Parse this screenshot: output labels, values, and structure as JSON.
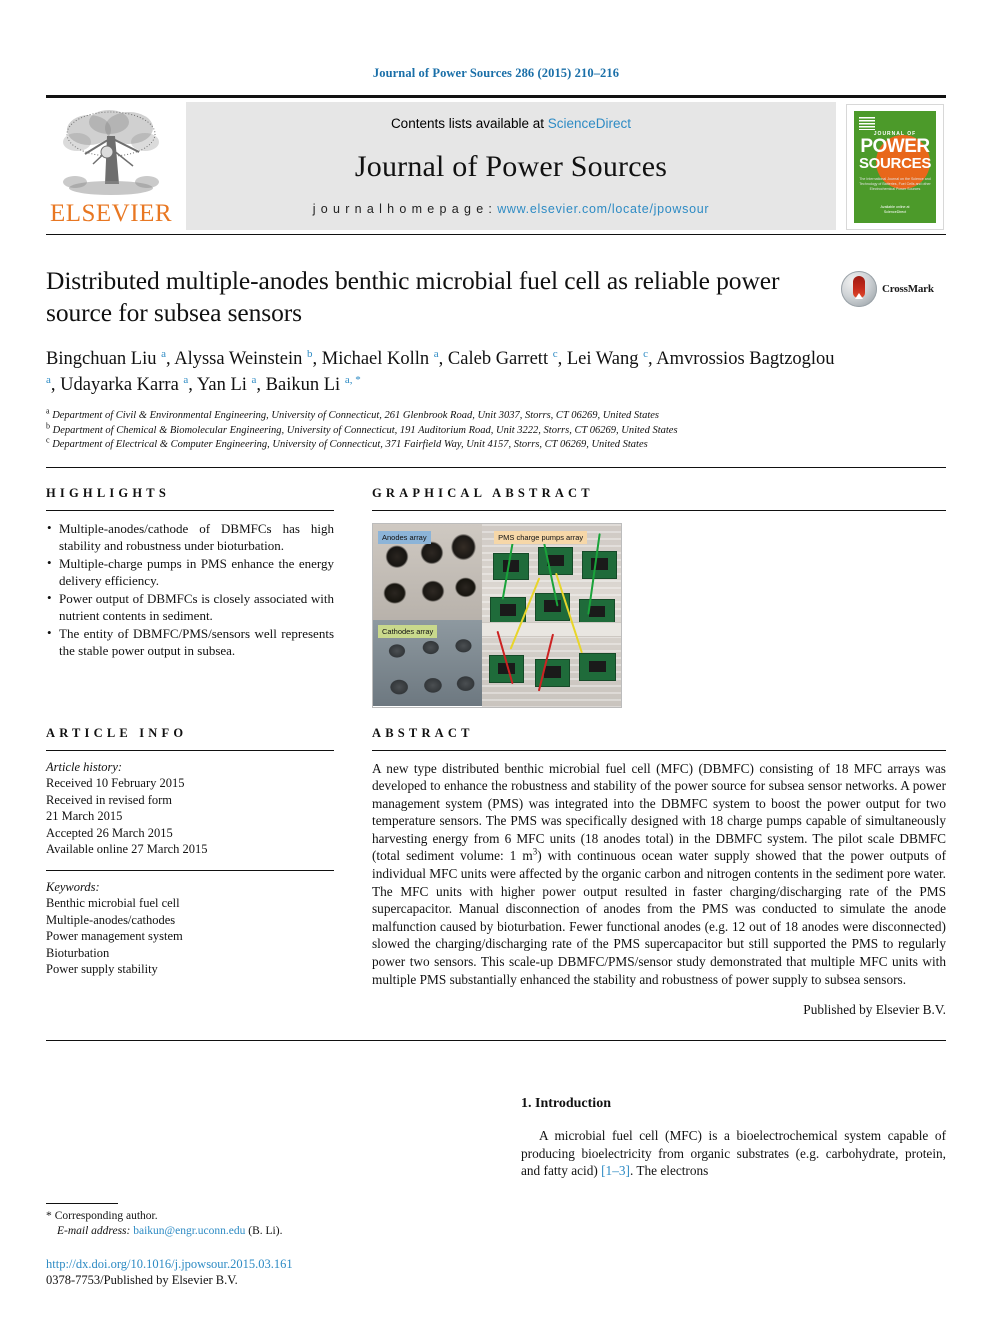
{
  "running_head": "Journal of Power Sources 286 (2015) 210–216",
  "masthead": {
    "publisher_name": "ELSEVIER",
    "contents_prefix": "Contents lists available at ",
    "contents_link": "ScienceDirect",
    "journal_title": "Journal of Power Sources",
    "homepage_prefix": "j o u r n a l   h o m e p a g e :   ",
    "homepage_url": "www.elsevier.com/locate/jpowsour",
    "cover": {
      "journal_of": "JOURNAL OF",
      "word1": "POWER",
      "word2": "SOURCES",
      "subtitle": "The International Journal on the Science and Technology of Batteries, Fuel Cells and other Electrochemical Power Sources",
      "footer": "Available online at\nScienceDirect"
    }
  },
  "title": "Distributed multiple-anodes benthic microbial fuel cell as reliable power source for subsea sensors",
  "crossmark_label": "CrossMark",
  "authors_html": "Bingchuan Liu <sup>a</sup>, Alyssa Weinstein <sup>b</sup>, Michael Kolln <sup>a</sup>, Caleb Garrett <sup>c</sup>, Lei Wang <sup>c</sup>, Amvrossios Bagtzoglou <sup>a</sup>, Udayarka Karra <sup>a</sup>, Yan Li <sup>a</sup>, Baikun Li <sup>a, *</sup>",
  "affiliations": [
    "Department of Civil & Environmental Engineering, University of Connecticut, 261 Glenbrook Road, Unit 3037, Storrs, CT 06269, United States",
    "Department of Chemical & Biomolecular Engineering, University of Connecticut, 191 Auditorium Road, Unit 3222, Storrs, CT 06269, United States",
    "Department of Electrical & Computer Engineering, University of Connecticut, 371 Fairfield Way, Unit 4157, Storrs, CT 06269, United States"
  ],
  "affiliation_markers": [
    "a",
    "b",
    "c"
  ],
  "highlights": {
    "heading": "HIGHLIGHTS",
    "items": [
      "Multiple-anodes/cathode of DBMFCs has high stability and robustness under bioturbation.",
      "Multiple-charge pumps in PMS enhance the energy delivery efficiency.",
      "Power output of DBMFCs is closely associated with nutrient contents in sediment.",
      "The entity of DBMFC/PMS/sensors well represents the stable power output in subsea."
    ]
  },
  "graphical_abstract": {
    "heading": "GRAPHICAL ABSTRACT",
    "labels": {
      "anodes": "Anodes array",
      "cathodes": "Cathodes array",
      "pms": "PMS charge pumps array"
    }
  },
  "article_info": {
    "heading": "ARTICLE INFO",
    "history_label": "Article history:",
    "history": [
      "Received 10 February 2015",
      "Received in revised form",
      "21 March 2015",
      "Accepted 26 March 2015",
      "Available online 27 March 2015"
    ],
    "keywords_label": "Keywords:",
    "keywords": [
      "Benthic microbial fuel cell",
      "Multiple-anodes/cathodes",
      "Power management system",
      "Bioturbation",
      "Power supply stability"
    ]
  },
  "abstract": {
    "heading": "ABSTRACT",
    "part1": "A new type distributed benthic microbial fuel cell (MFC) (DBMFC) consisting of 18 MFC arrays was developed to enhance the robustness and stability of the power source for subsea sensor networks. A power management system (PMS) was integrated into the DBMFC system to boost the power output for two temperature sensors. The PMS was specifically designed with 18 charge pumps capable of simultaneously harvesting energy from 6 MFC units (18 anodes total) in the DBMFC system. The pilot scale DBMFC (total sediment volume: 1 m",
    "sup": "3",
    "part2": ") with continuous ocean water supply showed that the power outputs of individual MFC units were affected by the organic carbon and nitrogen contents in the sediment pore water. The MFC units with higher power output resulted in faster charging/discharging rate of the PMS supercapacitor. Manual disconnection of anodes from the PMS was conducted to simulate the anode malfunction caused by bioturbation. Fewer functional anodes (e.g. 12 out of 18 anodes were disconnected) slowed the charging/discharging rate of the PMS supercapacitor but still supported the PMS to regularly power two sensors. This scale-up DBMFC/PMS/sensor study demonstrated that multiple MFC units with multiple PMS substantially enhanced the stability and robustness of power supply to subsea sensors.",
    "published_by": "Published by Elsevier B.V."
  },
  "introduction": {
    "heading": "1. Introduction",
    "part1": "A microbial fuel cell (MFC) is a bioelectrochemical system capable of producing bioelectricity from organic substrates (e.g. carbohydrate, protein, and fatty acid) ",
    "ref": "[1–3]",
    "part2": ". The electrons"
  },
  "footnote": {
    "star": "*",
    "corresponding": "Corresponding author.",
    "email_label": "E-mail address:",
    "email": "baikun@engr.uconn.edu",
    "email_owner": "(B. Li)."
  },
  "doi": "http://dx.doi.org/10.1016/j.jpowsour.2015.03.161",
  "issn_line": "0378-7753/Published by Elsevier B.V.",
  "colors": {
    "link": "#2e8bc4",
    "elsevier_orange": "#e87722",
    "cover_green": "#4c9a2a",
    "cover_sun": "#e8671a"
  }
}
